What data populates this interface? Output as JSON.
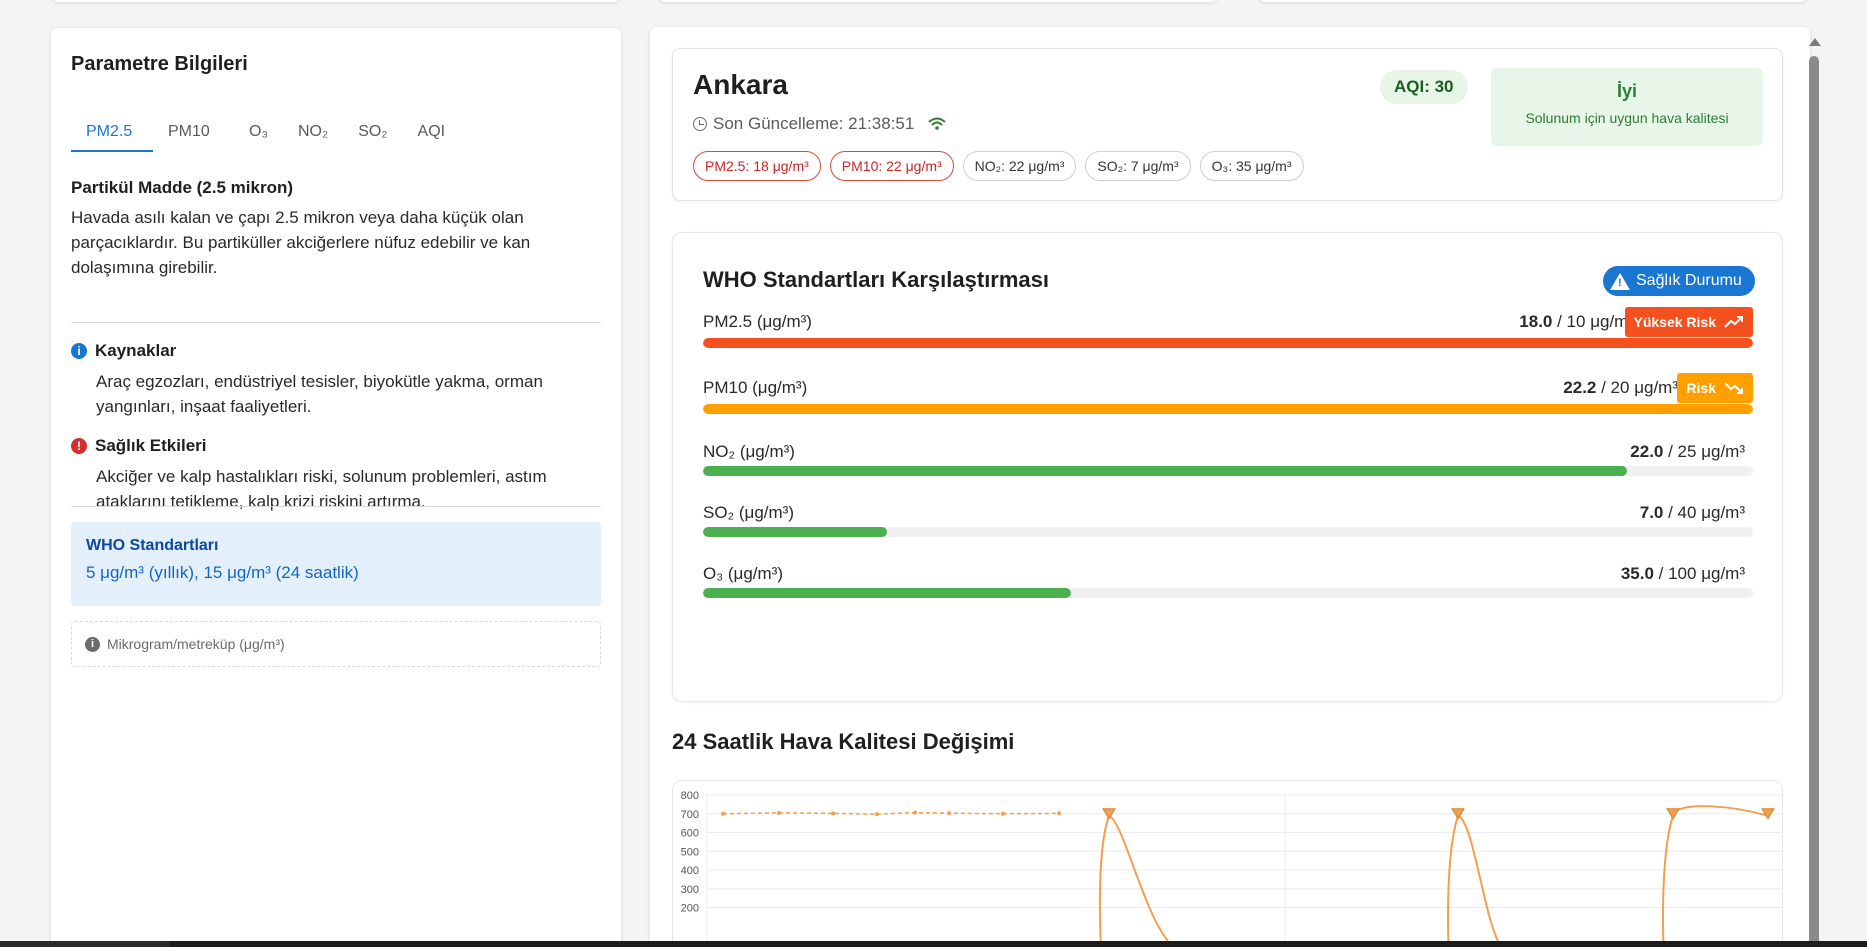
{
  "left": {
    "title": "Parametre Bilgileri",
    "tabs": [
      "PM2.5",
      "PM10",
      "O₃",
      "NO₂",
      "SO₂",
      "AQI"
    ],
    "active_tab": "PM2.5",
    "subtitle": "Partikül Madde (2.5 mikron)",
    "description": "Havada asılı kalan ve çapı 2.5 mikron veya daha küçük olan parçacıklardır. Bu partiküller akciğerlere nüfuz edebilir ve kan dolaşımına girebilir.",
    "sources_title": "Kaynaklar",
    "sources_text": "Araç egzozları, endüstriyel tesisler, biyokütle yakma, orman yangınları, inşaat faaliyetleri.",
    "health_title": "Sağlık Etkileri",
    "health_text": "Akciğer ve kalp hastalıkları riski, solunum problemleri, astım ataklarını tetikleme, kalp krizi riskini artırma.",
    "who_title": "WHO Standartları",
    "who_value": "5 μg/m³ (yıllık), 15 μg/m³ (24 saatlik)",
    "unit_note": "Mikrogram/metreküp (μg/m³)"
  },
  "city": {
    "name": "Ankara",
    "updated": "Son Güncelleme: 21:38:51",
    "aqi": "AQI: 30",
    "status": "İyi",
    "status_desc": "Solunum için uygun hava kalitesi",
    "chips": [
      {
        "text": "PM2.5: 18 μg/m³",
        "alert": true
      },
      {
        "text": "PM10: 22 μg/m³",
        "alert": true
      },
      {
        "text": "NO₂: 22 μg/m³",
        "alert": false
      },
      {
        "text": "SO₂: 7 μg/m³",
        "alert": false
      },
      {
        "text": "O₃: 35 μg/m³",
        "alert": false
      }
    ]
  },
  "who": {
    "title": "WHO Standartları Karşılaştırması",
    "health_button": "Sağlık Durumu",
    "rows": [
      {
        "label": "PM2.5 (μg/m³)",
        "value": "18.0",
        "limit": " / 10 μg/m³",
        "fraction": 1.0,
        "color": "#f4511e",
        "risk": "Yüksek Risk"
      },
      {
        "label": "PM10 (μg/m³)",
        "value": "22.2",
        "limit": " / 20 μg/m³",
        "fraction": 1.0,
        "color": "#ffa000",
        "risk": "Risk"
      },
      {
        "label": "NO₂ (μg/m³)",
        "value": "22.0",
        "limit": " / 25 μg/m³",
        "fraction": 0.88,
        "color": "#4caf50",
        "risk": ""
      },
      {
        "label": "SO₂ (μg/m³)",
        "value": "7.0",
        "limit": " / 40 μg/m³",
        "fraction": 0.175,
        "color": "#4caf50",
        "risk": ""
      },
      {
        "label": "O₃ (μg/m³)",
        "value": "35.0",
        "limit": " / 100 μg/m³",
        "fraction": 0.35,
        "color": "#4caf50",
        "risk": ""
      }
    ]
  },
  "chart_title": "24 Saatlik Hava Kalitesi Değişimi",
  "chart_data": {
    "type": "line",
    "yticks": [
      "800",
      "700",
      "600",
      "500",
      "400",
      "300",
      "200"
    ],
    "ylim": [
      200,
      800
    ],
    "series": [
      {
        "values": [
          700,
          705,
          702,
          698,
          706,
          703,
          700,
          702
        ],
        "color": "#f0a050"
      }
    ]
  }
}
